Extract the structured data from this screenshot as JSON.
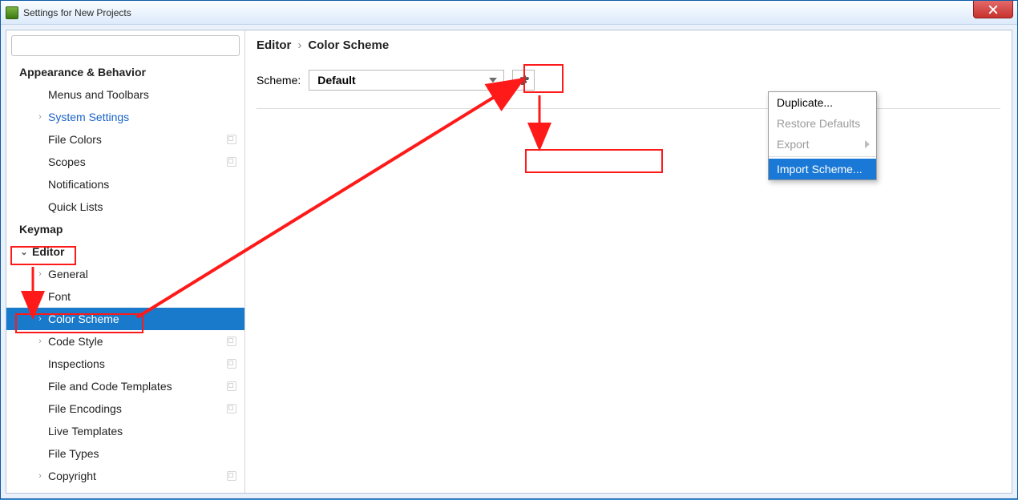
{
  "window": {
    "title": "Settings for New Projects"
  },
  "search": {
    "placeholder": ""
  },
  "sidebar": {
    "items": [
      {
        "label": "Appearance & Behavior"
      },
      {
        "label": "Menus and Toolbars"
      },
      {
        "label": "System Settings"
      },
      {
        "label": "File Colors"
      },
      {
        "label": "Scopes"
      },
      {
        "label": "Notifications"
      },
      {
        "label": "Quick Lists"
      },
      {
        "label": "Keymap"
      },
      {
        "label": "Editor"
      },
      {
        "label": "General"
      },
      {
        "label": "Font"
      },
      {
        "label": "Color Scheme"
      },
      {
        "label": "Code Style"
      },
      {
        "label": "Inspections"
      },
      {
        "label": "File and Code Templates"
      },
      {
        "label": "File Encodings"
      },
      {
        "label": "Live Templates"
      },
      {
        "label": "File Types"
      },
      {
        "label": "Copyright"
      }
    ]
  },
  "breadcrumb": {
    "a": "Editor",
    "sep": "›",
    "b": "Color Scheme"
  },
  "scheme": {
    "label": "Scheme:",
    "value": "Default"
  },
  "menu": {
    "duplicate": "Duplicate...",
    "restore": "Restore Defaults",
    "export": "Export",
    "import": "Import Scheme..."
  }
}
